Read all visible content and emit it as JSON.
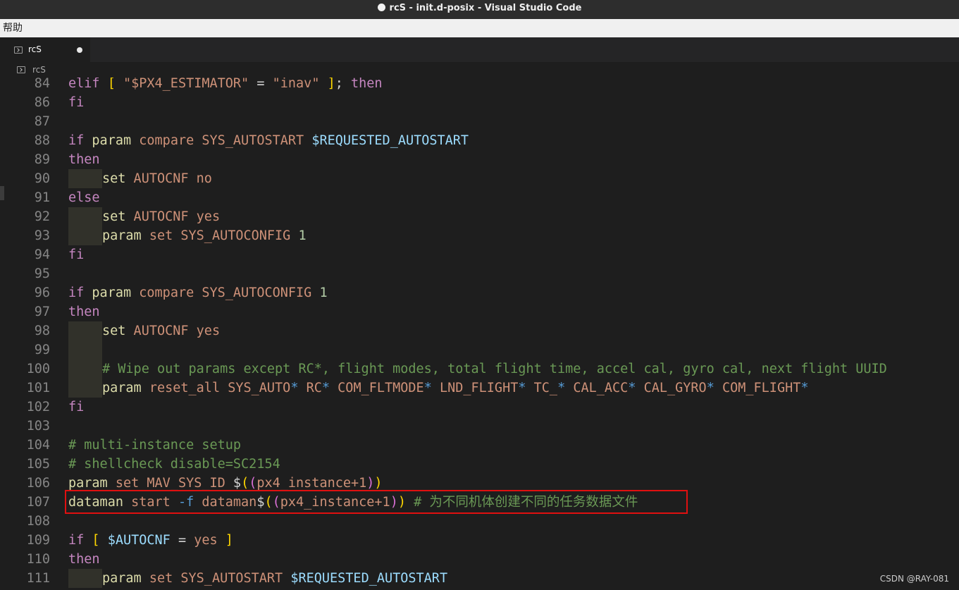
{
  "window": {
    "title": "rcS - init.d-posix - Visual Studio Code"
  },
  "menubar": {
    "items": [
      "帮助"
    ]
  },
  "tabs": [
    {
      "label": "rcS",
      "icon": "terminal-file-icon",
      "dirty": true
    }
  ],
  "breadcrumb": {
    "label": "rcS",
    "icon": "terminal-file-icon"
  },
  "watermark": "CSDN @RAY-081",
  "colors": {
    "keyword": "#c586c0",
    "command": "#dcdcaa",
    "string": "#ce9178",
    "variable": "#9cdcfe",
    "number": "#b5cea8",
    "comment": "#6a9955",
    "highlight_box": "#e01010"
  },
  "code_lines": [
    {
      "n": "84",
      "indent": 0,
      "tokens": [
        [
          "kw",
          "elif "
        ],
        [
          "br1",
          "[ "
        ],
        [
          "arg",
          "\"$PX4_ESTIMATOR\""
        ],
        [
          "op",
          " = "
        ],
        [
          "arg",
          "\"inav\""
        ],
        [
          "br1",
          " ]"
        ],
        [
          "op",
          "; "
        ],
        [
          "kw",
          "then"
        ]
      ]
    },
    {
      "n": "86",
      "indent": 0,
      "tokens": [
        [
          "kw",
          "fi"
        ]
      ]
    },
    {
      "n": "87",
      "indent": 0,
      "tokens": []
    },
    {
      "n": "88",
      "indent": 0,
      "tokens": [
        [
          "kw",
          "if "
        ],
        [
          "cmd",
          "param"
        ],
        [
          "arg",
          " compare SYS_AUTOSTART "
        ],
        [
          "var",
          "$REQUESTED_AUTOSTART"
        ]
      ]
    },
    {
      "n": "89",
      "indent": 0,
      "tokens": [
        [
          "kw",
          "then"
        ]
      ]
    },
    {
      "n": "90",
      "indent": 1,
      "tokens": [
        [
          "cmd",
          "set"
        ],
        [
          "arg",
          " AUTOCNF no"
        ]
      ]
    },
    {
      "n": "91",
      "indent": 0,
      "tokens": [
        [
          "kw",
          "else"
        ]
      ]
    },
    {
      "n": "92",
      "indent": 1,
      "tokens": [
        [
          "cmd",
          "set"
        ],
        [
          "arg",
          " AUTOCNF yes"
        ]
      ]
    },
    {
      "n": "93",
      "indent": 1,
      "tokens": [
        [
          "cmd",
          "param"
        ],
        [
          "arg",
          " set SYS_AUTOCONFIG "
        ],
        [
          "num",
          "1"
        ]
      ]
    },
    {
      "n": "94",
      "indent": 0,
      "tokens": [
        [
          "kw",
          "fi"
        ]
      ]
    },
    {
      "n": "95",
      "indent": 0,
      "tokens": []
    },
    {
      "n": "96",
      "indent": 0,
      "tokens": [
        [
          "kw",
          "if "
        ],
        [
          "cmd",
          "param"
        ],
        [
          "arg",
          " compare SYS_AUTOCONFIG "
        ],
        [
          "num",
          "1"
        ]
      ]
    },
    {
      "n": "97",
      "indent": 0,
      "tokens": [
        [
          "kw",
          "then"
        ]
      ]
    },
    {
      "n": "98",
      "indent": 1,
      "tokens": [
        [
          "cmd",
          "set"
        ],
        [
          "arg",
          " AUTOCNF yes"
        ]
      ]
    },
    {
      "n": "99",
      "indent": 1,
      "tokens": []
    },
    {
      "n": "100",
      "indent": 1,
      "tokens": [
        [
          "cm",
          "# Wipe out params except RC*, flight modes, total flight time, accel cal, gyro cal, next flight UUID"
        ]
      ]
    },
    {
      "n": "101",
      "indent": 1,
      "tokens": [
        [
          "cmd",
          "param"
        ],
        [
          "arg",
          " reset_all SYS_AUTO"
        ],
        [
          "glob",
          "*"
        ],
        [
          "arg",
          " RC"
        ],
        [
          "glob",
          "*"
        ],
        [
          "arg",
          " COM_FLTMODE"
        ],
        [
          "glob",
          "*"
        ],
        [
          "arg",
          " LND_FLIGHT"
        ],
        [
          "glob",
          "*"
        ],
        [
          "arg",
          " TC_"
        ],
        [
          "glob",
          "*"
        ],
        [
          "arg",
          " CAL_ACC"
        ],
        [
          "glob",
          "*"
        ],
        [
          "arg",
          " CAL_GYRO"
        ],
        [
          "glob",
          "*"
        ],
        [
          "arg",
          " COM_FLIGHT"
        ],
        [
          "glob",
          "*"
        ]
      ]
    },
    {
      "n": "102",
      "indent": 0,
      "tokens": [
        [
          "kw",
          "fi"
        ]
      ]
    },
    {
      "n": "103",
      "indent": 0,
      "tokens": []
    },
    {
      "n": "104",
      "indent": 0,
      "tokens": [
        [
          "cm",
          "# multi-instance setup"
        ]
      ]
    },
    {
      "n": "105",
      "indent": 0,
      "tokens": [
        [
          "cm",
          "# shellcheck disable=SC2154"
        ]
      ]
    },
    {
      "n": "106",
      "indent": 0,
      "tokens": [
        [
          "cmd",
          "param"
        ],
        [
          "arg",
          " set MAV_SYS_ID "
        ],
        [
          "op",
          "$"
        ],
        [
          "br1",
          "("
        ],
        [
          "br2",
          "("
        ],
        [
          "arg",
          "px4_instance+1"
        ],
        [
          "br2",
          ")"
        ],
        [
          "br1",
          ")"
        ]
      ]
    },
    {
      "n": "107",
      "indent": 0,
      "tokens": [
        [
          "cmd",
          "dataman"
        ],
        [
          "arg",
          " start "
        ],
        [
          "glob",
          "-f"
        ],
        [
          "arg",
          " dataman"
        ],
        [
          "op",
          "$"
        ],
        [
          "br1",
          "("
        ],
        [
          "br2",
          "("
        ],
        [
          "arg",
          "px4_instance+1"
        ],
        [
          "br2",
          ")"
        ],
        [
          "br1",
          ")"
        ],
        [
          "cm",
          " # 为不同机体创建不同的任务数据文件"
        ]
      ]
    },
    {
      "n": "108",
      "indent": 0,
      "tokens": []
    },
    {
      "n": "109",
      "indent": 0,
      "tokens": [
        [
          "kw",
          "if "
        ],
        [
          "br1",
          "["
        ],
        [
          "var",
          " $AUTOCNF"
        ],
        [
          "op",
          " = "
        ],
        [
          "arg",
          "yes"
        ],
        [
          "br1",
          " ]"
        ]
      ]
    },
    {
      "n": "110",
      "indent": 0,
      "tokens": [
        [
          "kw",
          "then"
        ]
      ]
    },
    {
      "n": "111",
      "indent": 1,
      "tokens": [
        [
          "cmd",
          "param"
        ],
        [
          "arg",
          " set SYS_AUTOSTART "
        ],
        [
          "var",
          "$REQUESTED_AUTOSTART"
        ]
      ]
    }
  ]
}
